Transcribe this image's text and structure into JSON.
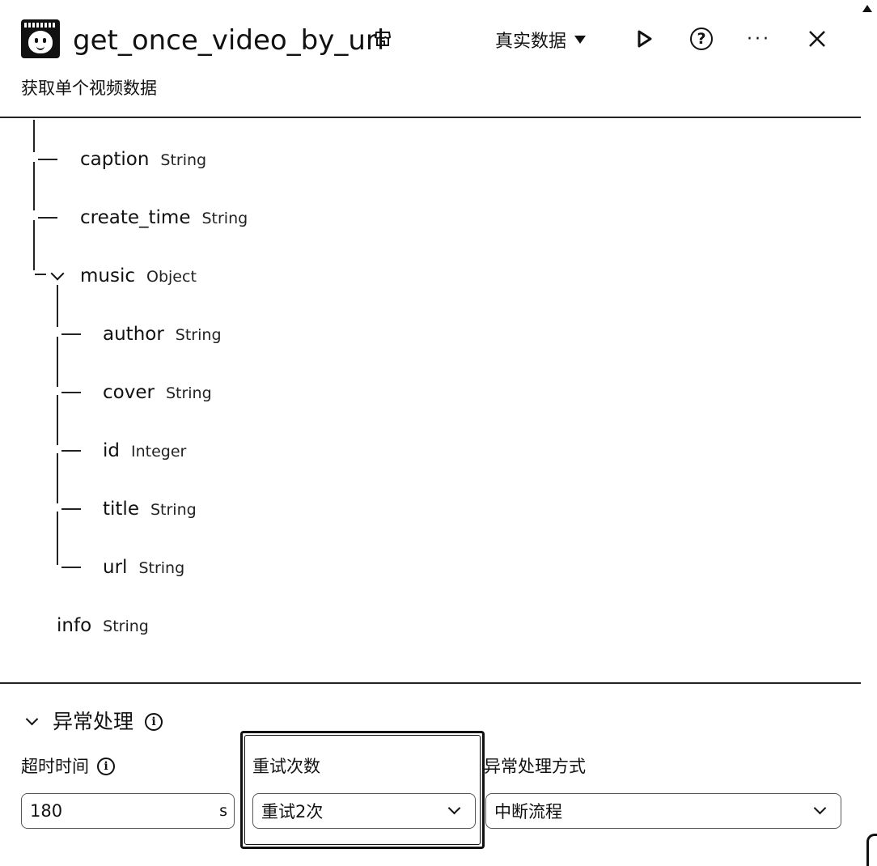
{
  "header": {
    "title": "get_once_video_by_url",
    "mode_label": "真实数据",
    "more_label": "···"
  },
  "subtitle": "获取单个视频数据",
  "tree": {
    "caption": {
      "name": "caption",
      "type": "String"
    },
    "create_time": {
      "name": "create_time",
      "type": "String"
    },
    "music": {
      "name": "music",
      "type": "Object"
    },
    "author": {
      "name": "author",
      "type": "String"
    },
    "cover": {
      "name": "cover",
      "type": "String"
    },
    "id": {
      "name": "id",
      "type": "Integer"
    },
    "title": {
      "name": "title",
      "type": "String"
    },
    "url": {
      "name": "url",
      "type": "String"
    },
    "info": {
      "name": "info",
      "type": "String"
    }
  },
  "exception": {
    "section_title": "异常处理",
    "timeout": {
      "label": "超时时间",
      "value": "180",
      "unit": "s"
    },
    "retry": {
      "label": "重试次数",
      "value": "重试2次"
    },
    "handling": {
      "label": "异常处理方式",
      "value": "中断流程"
    }
  }
}
